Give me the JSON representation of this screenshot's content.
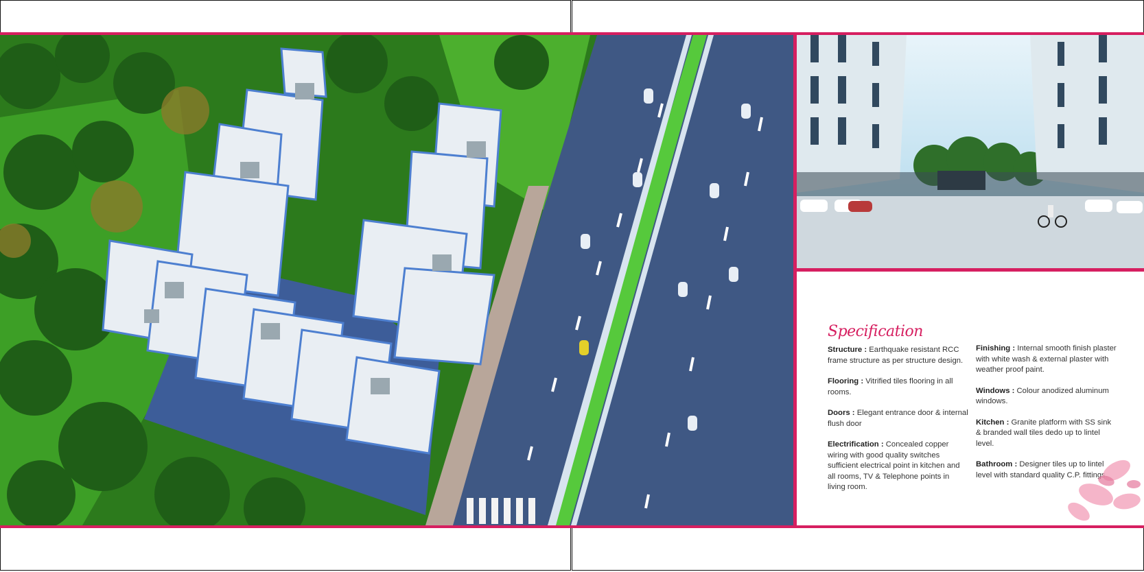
{
  "specification": {
    "title": "Specification",
    "column_left": [
      {
        "key": "Structure :",
        "text": "Earthquake resistant RCC frame structure as per structure design."
      },
      {
        "key": "Flooring :",
        "text": "Vitrified tiles flooring in all rooms."
      },
      {
        "key": "Doors :",
        "text": "Elegant entrance door & internal flush door"
      },
      {
        "key": "Electrification :",
        "text": "Concealed copper wiring with good quality switches sufficient electrical point in kitchen and all rooms, TV & Telephone points in living room."
      }
    ],
    "column_right": [
      {
        "key": "Finishing :",
        "text": "Internal smooth finish plaster with white wash & external plaster with weather proof paint."
      },
      {
        "key": "Windows :",
        "text": "Colour anodized aluminum windows."
      },
      {
        "key": "Kitchen :",
        "text": "Granite platform with SS sink & branded wall tiles dedo up to lintel level."
      },
      {
        "key": "Bathroom :",
        "text": "Designer tiles up to lintel level with standard quality C.P. fittings."
      }
    ]
  },
  "colors": {
    "accent": "#d61f60",
    "lawn": "#3a9a23",
    "road": "#3f5884",
    "building": "#eef2f5"
  }
}
